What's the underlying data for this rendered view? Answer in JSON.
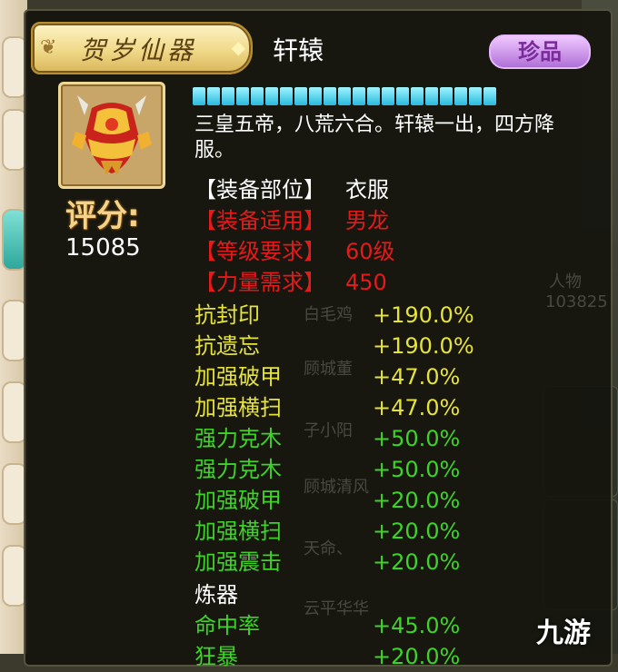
{
  "colors": {
    "white": "#ffffff",
    "red": "#e61a1a",
    "yellow": "#e6e33a",
    "green": "#3fd32a",
    "gold": "#f5d28a"
  },
  "banner": {
    "title": "贺岁仙器"
  },
  "item": {
    "name": "轩辕",
    "rarity": "珍品",
    "icon": "golden-armor-icon",
    "durability": {
      "fraction": 1.0
    },
    "description": "三皇五帝，八荒六合。轩辕一出，四方降服。"
  },
  "score": {
    "label": "评分:",
    "value": "15085"
  },
  "requirements": [
    {
      "label": "【装备部位】",
      "value": "衣服",
      "color": "white"
    },
    {
      "label": "【装备适用】",
      "value": "男龙",
      "color": "red"
    },
    {
      "label": "【等级要求】",
      "value": "60级",
      "color": "red"
    },
    {
      "label": "【力量需求】",
      "value": "450",
      "color": "red"
    }
  ],
  "stats": [
    {
      "label": "抗封印",
      "value": "+190.0%",
      "color": "yellow"
    },
    {
      "label": "抗遗忘",
      "value": "+190.0%",
      "color": "yellow"
    },
    {
      "label": "加强破甲",
      "value": "+47.0%",
      "color": "yellow"
    },
    {
      "label": "加强横扫",
      "value": "+47.0%",
      "color": "yellow"
    },
    {
      "label": "强力克木",
      "value": "+50.0%",
      "color": "green"
    },
    {
      "label": "强力克木",
      "value": "+50.0%",
      "color": "green"
    },
    {
      "label": "加强破甲",
      "value": "+20.0%",
      "color": "green"
    },
    {
      "label": "加强横扫",
      "value": "+20.0%",
      "color": "green"
    },
    {
      "label": "加强震击",
      "value": "+20.0%",
      "color": "green"
    }
  ],
  "refine": {
    "title": "炼器",
    "stats": [
      {
        "label": "命中率",
        "value": "+45.0%",
        "color": "green"
      },
      {
        "label": "狂暴",
        "value": "+20.0%",
        "color": "green"
      }
    ]
  },
  "background": {
    "ghost_names": [
      "白毛鸡",
      "顾城董",
      "子小阳",
      "顾城清风",
      "天命、",
      "云平华华"
    ],
    "player_label": "人物",
    "player_value": "103825"
  },
  "watermark": "九游"
}
